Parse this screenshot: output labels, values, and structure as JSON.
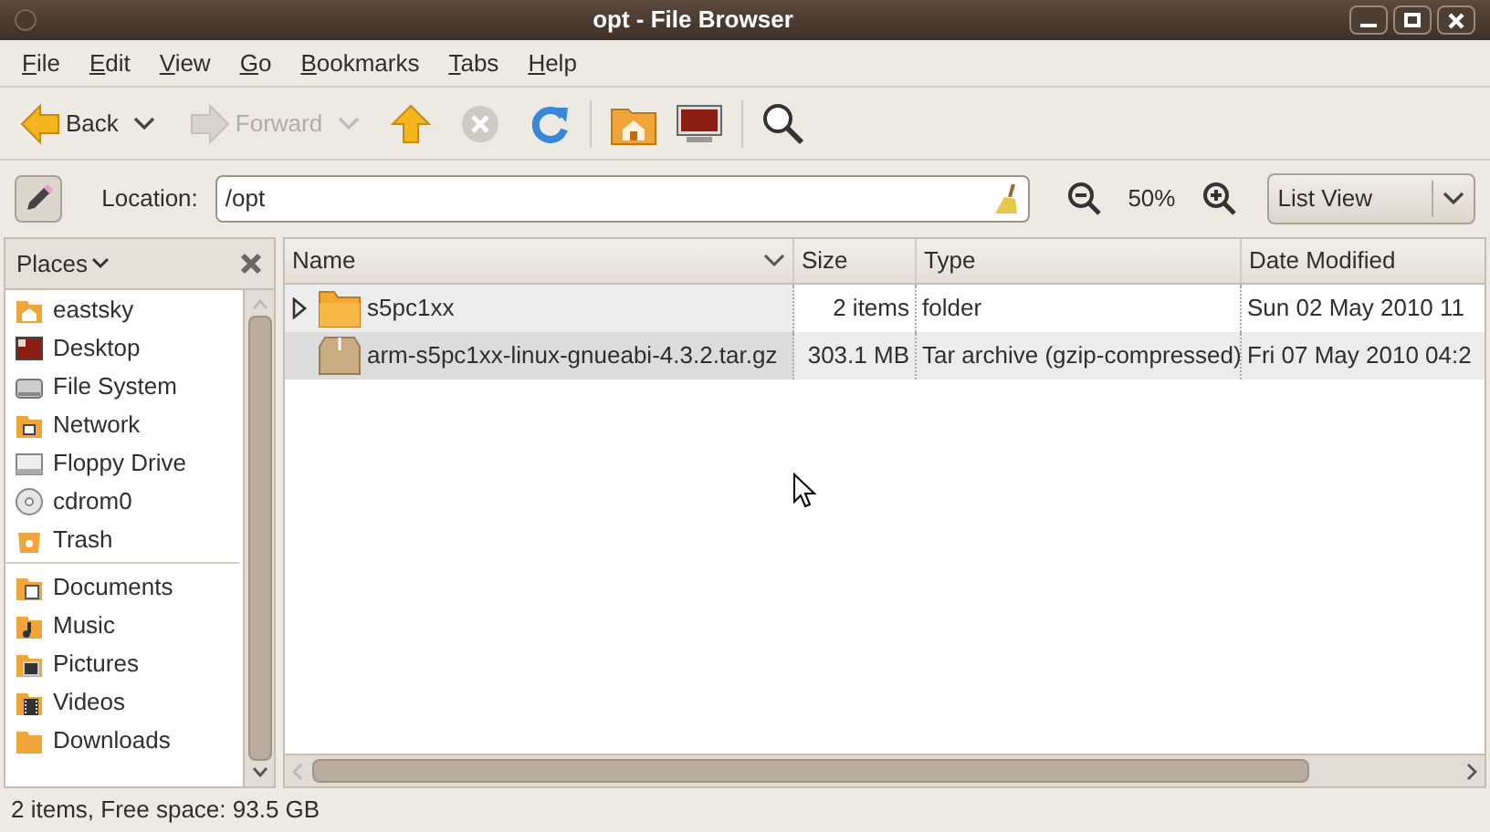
{
  "window": {
    "title": "opt - File Browser"
  },
  "menu": [
    "File",
    "Edit",
    "View",
    "Go",
    "Bookmarks",
    "Tabs",
    "Help"
  ],
  "toolbar": {
    "back": {
      "label": "Back",
      "disabled": false
    },
    "forward": {
      "label": "Forward",
      "disabled": true
    },
    "stop": {
      "disabled": true
    }
  },
  "location": {
    "label": "Location:",
    "value": "/opt",
    "zoom": "50%",
    "view": "List View"
  },
  "sidebar": {
    "title": "Places",
    "items": [
      {
        "label": "eastsky"
      },
      {
        "label": "Desktop"
      },
      {
        "label": "File System"
      },
      {
        "label": "Network"
      },
      {
        "label": "Floppy Drive"
      },
      {
        "label": "cdrom0"
      },
      {
        "label": "Trash"
      }
    ],
    "bookmarks": [
      {
        "label": "Documents"
      },
      {
        "label": "Music"
      },
      {
        "label": "Pictures"
      },
      {
        "label": "Videos"
      },
      {
        "label": "Downloads"
      }
    ]
  },
  "table": {
    "columns": [
      "Name",
      "Size",
      "Type",
      "Date Modified"
    ],
    "rows": [
      {
        "kind": "folder",
        "expanded": false,
        "selected": false,
        "cells": [
          "s5pc1xx",
          "2 items",
          "folder",
          "Sun 02 May 2010 11"
        ]
      },
      {
        "kind": "archive",
        "selected": true,
        "cells": [
          "arm-s5pc1xx-linux-gnueabi-4.3.2.tar.gz",
          "303.1 MB",
          "Tar archive (gzip-compressed)",
          "Fri 07 May 2010 04:2"
        ]
      }
    ]
  },
  "status_bar": "2 items, Free space: 93.5 GB"
}
